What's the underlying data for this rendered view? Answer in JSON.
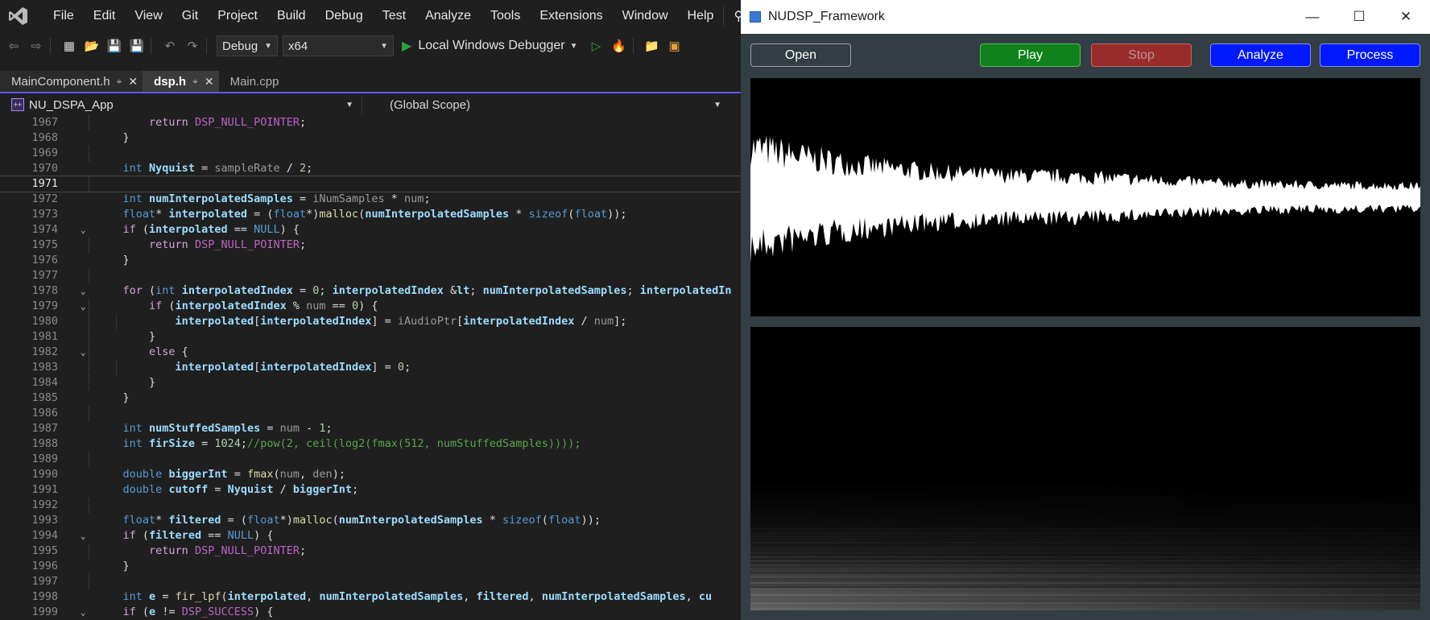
{
  "ide": {
    "menu": [
      "File",
      "Edit",
      "View",
      "Git",
      "Project",
      "Build",
      "Debug",
      "Test",
      "Analyze",
      "Tools",
      "Extensions",
      "Window",
      "Help"
    ],
    "search_label": "Se",
    "toolbar": {
      "config": "Debug",
      "platform": "x64",
      "debugger": "Local Windows Debugger"
    },
    "tabs": [
      "MainComponent.h",
      "dsp.h",
      "Main.cpp"
    ],
    "active_tab": "dsp.h",
    "nav": {
      "project": "NU_DSPA_App",
      "scope": "(Global Scope)"
    },
    "current_line": 1971,
    "code_lines": [
      {
        "n": 1967,
        "t": "        return DSP_NULL_POINTER;"
      },
      {
        "n": 1968,
        "t": "    }"
      },
      {
        "n": 1969,
        "t": ""
      },
      {
        "n": 1970,
        "t": "    int Nyquist = sampleRate / 2;"
      },
      {
        "n": 1971,
        "t": ""
      },
      {
        "n": 1972,
        "t": "    int numInterpolatedSamples = iNumSamples * num;"
      },
      {
        "n": 1973,
        "t": "    float* interpolated = (float*)malloc(numInterpolatedSamples * sizeof(float));"
      },
      {
        "n": 1974,
        "t": "    if (interpolated == NULL) {"
      },
      {
        "n": 1975,
        "t": "        return DSP_NULL_POINTER;"
      },
      {
        "n": 1976,
        "t": "    }"
      },
      {
        "n": 1977,
        "t": ""
      },
      {
        "n": 1978,
        "t": "    for (int interpolatedIndex = 0; interpolatedIndex < numInterpolatedSamples; interpolatedIn"
      },
      {
        "n": 1979,
        "t": "        if (interpolatedIndex % num == 0) {"
      },
      {
        "n": 1980,
        "t": "            interpolated[interpolatedIndex] = iAudioPtr[interpolatedIndex / num];"
      },
      {
        "n": 1981,
        "t": "        }"
      },
      {
        "n": 1982,
        "t": "        else {"
      },
      {
        "n": 1983,
        "t": "            interpolated[interpolatedIndex] = 0;"
      },
      {
        "n": 1984,
        "t": "        }"
      },
      {
        "n": 1985,
        "t": "    }"
      },
      {
        "n": 1986,
        "t": ""
      },
      {
        "n": 1987,
        "t": "    int numStuffedSamples = num - 1;"
      },
      {
        "n": 1988,
        "t": "    int firSize = 1024;//pow(2, ceil(log2(fmax(512, numStuffedSamples))));"
      },
      {
        "n": 1989,
        "t": ""
      },
      {
        "n": 1990,
        "t": "    double biggerInt = fmax(num, den);"
      },
      {
        "n": 1991,
        "t": "    double cutoff = Nyquist / biggerInt;"
      },
      {
        "n": 1992,
        "t": ""
      },
      {
        "n": 1993,
        "t": "    float* filtered = (float*)malloc(numInterpolatedSamples * sizeof(float));"
      },
      {
        "n": 1994,
        "t": "    if (filtered == NULL) {"
      },
      {
        "n": 1995,
        "t": "        return DSP_NULL_POINTER;"
      },
      {
        "n": 1996,
        "t": "    }"
      },
      {
        "n": 1997,
        "t": ""
      },
      {
        "n": 1998,
        "t": "    int e = fir_lpf(interpolated, numInterpolatedSamples, filtered, numInterpolatedSamples, cu"
      },
      {
        "n": 1999,
        "t": "    if (e != DSP_SUCCESS) {"
      }
    ]
  },
  "app": {
    "title": "NUDSP_Framework",
    "buttons": {
      "open": "Open",
      "play": "Play",
      "stop": "Stop",
      "analyze": "Analyze",
      "process": "Process"
    },
    "colors": {
      "background": "#323e44",
      "play": "#10821b",
      "stop": "#9a2b2b",
      "action_blue": "#0019ff"
    }
  }
}
